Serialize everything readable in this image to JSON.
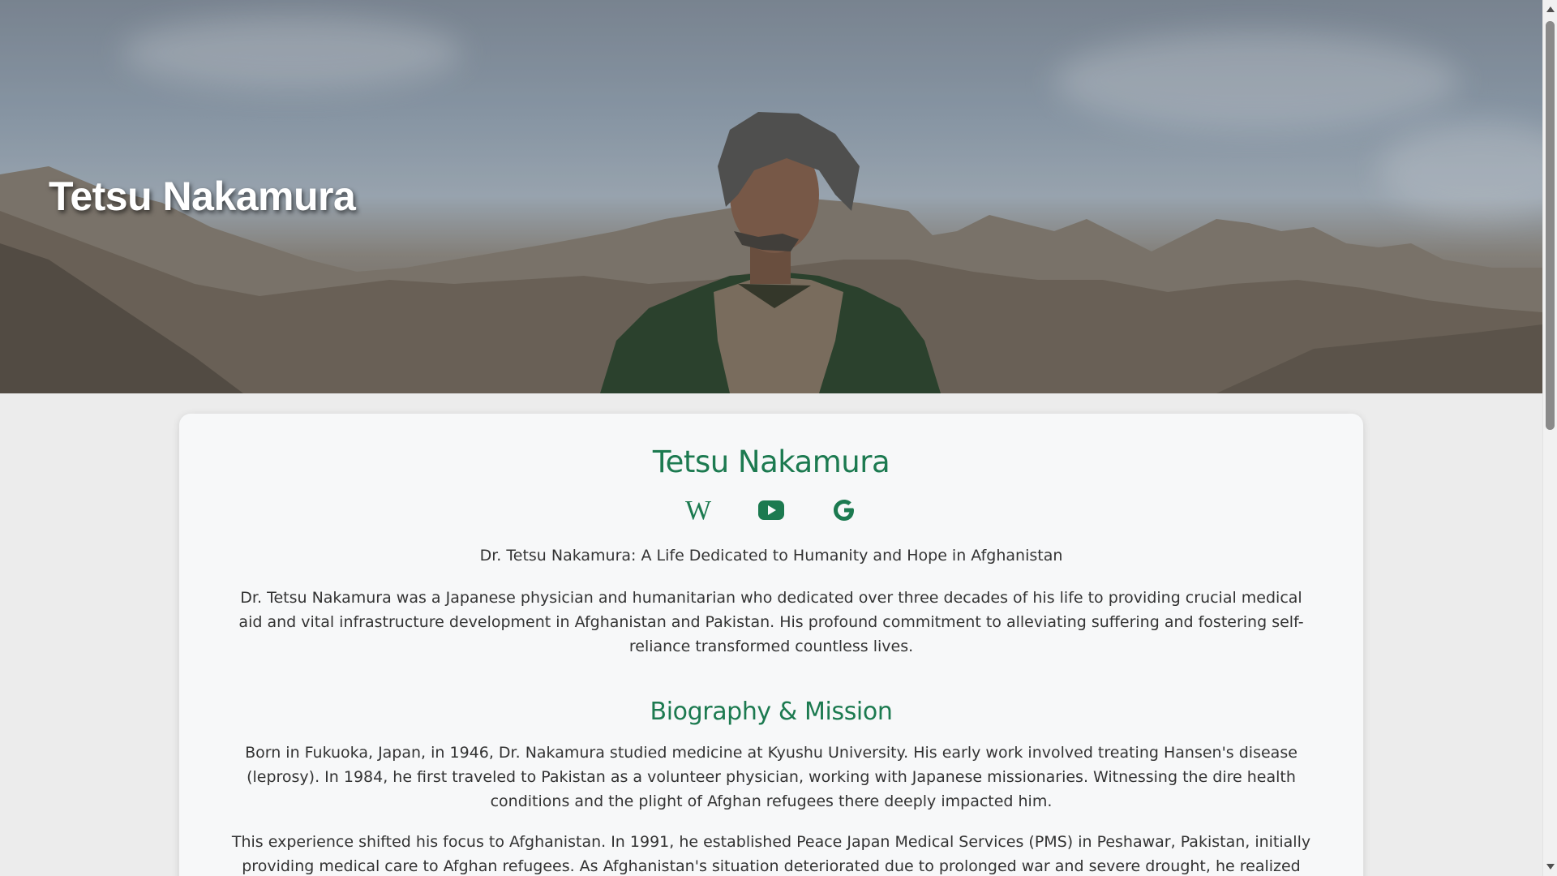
{
  "hero": {
    "title": "Tetsu Nakamura",
    "image_description": "Man in green jacket in front of mountains"
  },
  "profile": {
    "name": "Tetsu Nakamura",
    "links": [
      {
        "name": "wikipedia",
        "icon": "wikipedia-icon"
      },
      {
        "name": "youtube",
        "icon": "youtube-icon"
      },
      {
        "name": "google",
        "icon": "google-icon"
      }
    ],
    "tagline": "Dr. Tetsu Nakamura: A Life Dedicated to Humanity and Hope in Afghanistan",
    "intro": "Dr. Tetsu Nakamura was a Japanese physician and humanitarian who dedicated over three decades of his life to providing crucial medical aid and vital infrastructure development in Afghanistan and Pakistan. His profound commitment to alleviating suffering and fostering self-reliance transformed countless lives."
  },
  "biography": {
    "heading": "Biography & Mission",
    "paragraphs": [
      "Born in Fukuoka, Japan, in 1946, Dr. Nakamura studied medicine at Kyushu University. His early work involved treating Hansen's disease (leprosy). In 1984, he first traveled to Pakistan as a volunteer physician, working with Japanese missionaries. Witnessing the dire health conditions and the plight of Afghan refugees there deeply impacted him.",
      "This experience shifted his focus to Afghanistan. In 1991, he established Peace Japan Medical Services (PMS) in Peshawar, Pakistan, initially providing medical care to Afghan refugees. As Afghanistan's situation deteriorated due to prolonged war and severe drought, he realized that medical treatment"
    ]
  },
  "colors": {
    "accent": "#1c7a50",
    "card_bg": "#f7f8f9",
    "page_bg": "#ececec",
    "text": "#333333"
  }
}
